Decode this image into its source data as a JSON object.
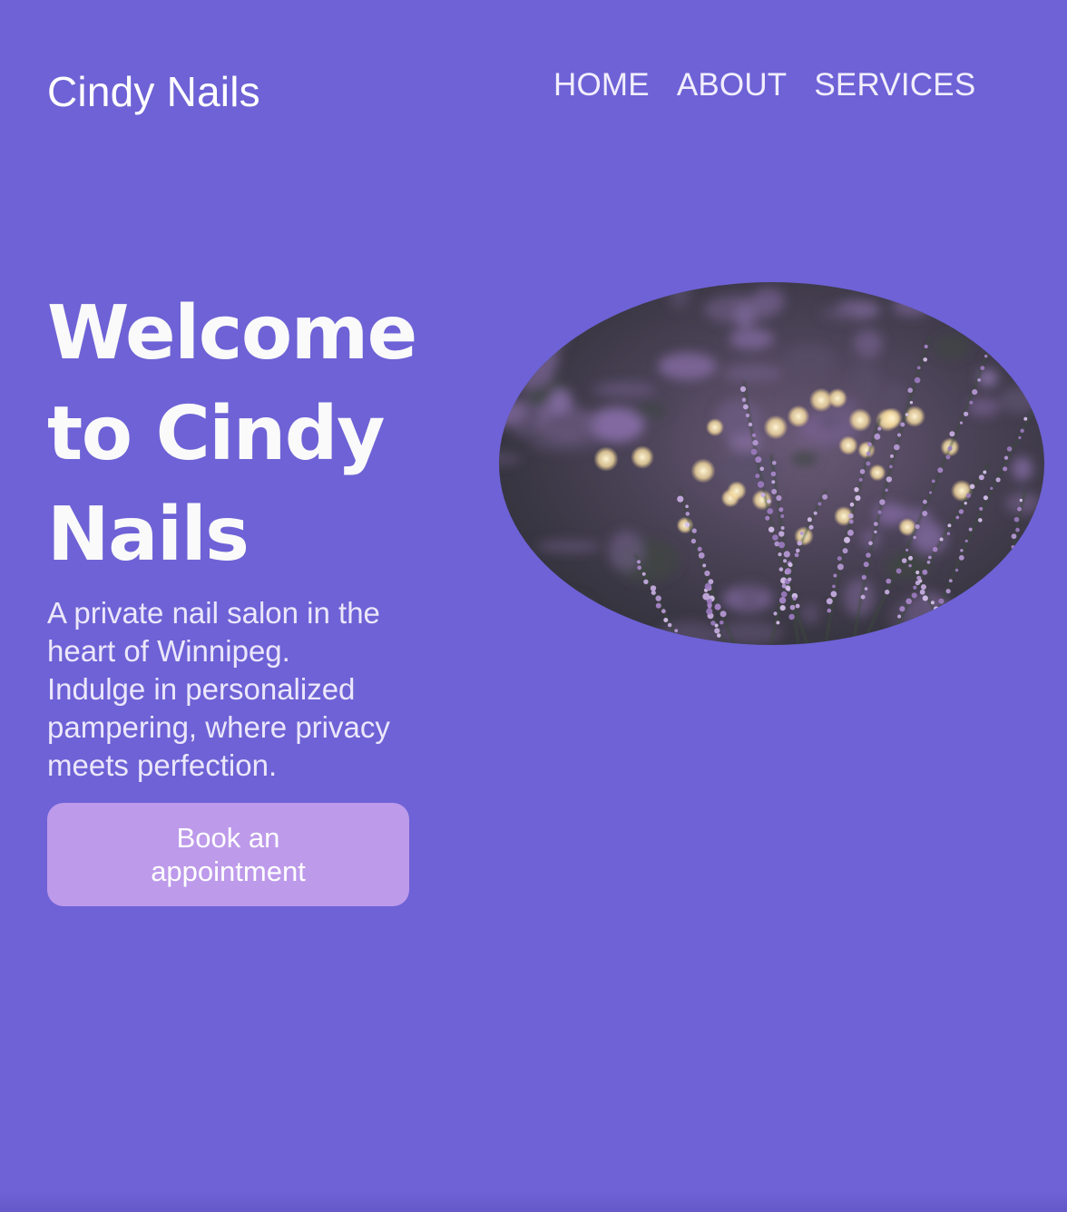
{
  "header": {
    "logo": "Cindy Nails",
    "nav": [
      {
        "label": "HOME"
      },
      {
        "label": "ABOUT"
      },
      {
        "label": "SERVICES"
      }
    ]
  },
  "hero": {
    "title": "Welcome to Cindy Nails",
    "subtitle": "A private nail salon in the heart of Winnipeg. Indulge in personalized pampering, where privacy meets perfection.",
    "cta_label": "Book an appointment",
    "image": {
      "subject": "lavender-flowers-photo",
      "shape": "ellipse"
    }
  },
  "colors": {
    "background": "#6e62d6",
    "cta": "#bd9aea",
    "text": "#ffffff"
  }
}
